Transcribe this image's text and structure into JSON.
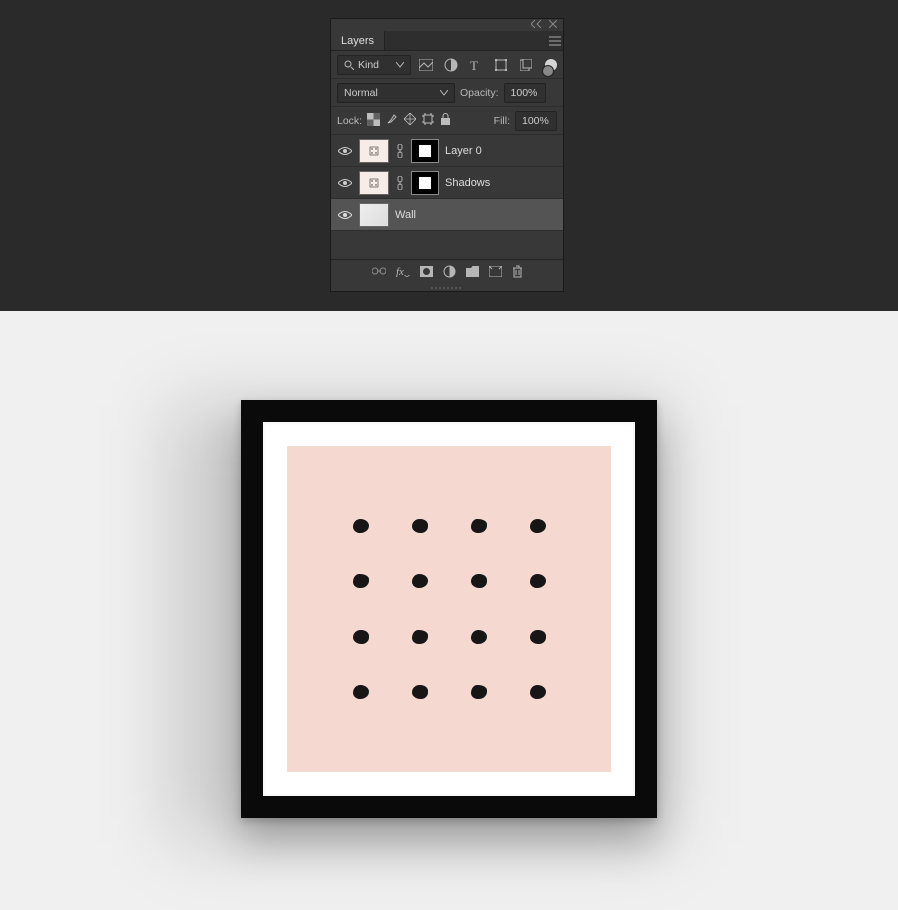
{
  "panel": {
    "title": "Layers",
    "filter": {
      "kind_label": "Kind"
    },
    "blend": {
      "mode": "Normal",
      "opacity_label": "Opacity:",
      "opacity_value": "100%"
    },
    "lock": {
      "label": "Lock:",
      "fill_label": "Fill:",
      "fill_value": "100%"
    },
    "layers": [
      {
        "name": "Layer 0",
        "has_mask": true,
        "selected": false,
        "thumb": "pink"
      },
      {
        "name": "Shadows",
        "has_mask": true,
        "selected": false,
        "thumb": "pink"
      },
      {
        "name": "Wall",
        "has_mask": false,
        "selected": true,
        "thumb": "grey"
      }
    ]
  }
}
